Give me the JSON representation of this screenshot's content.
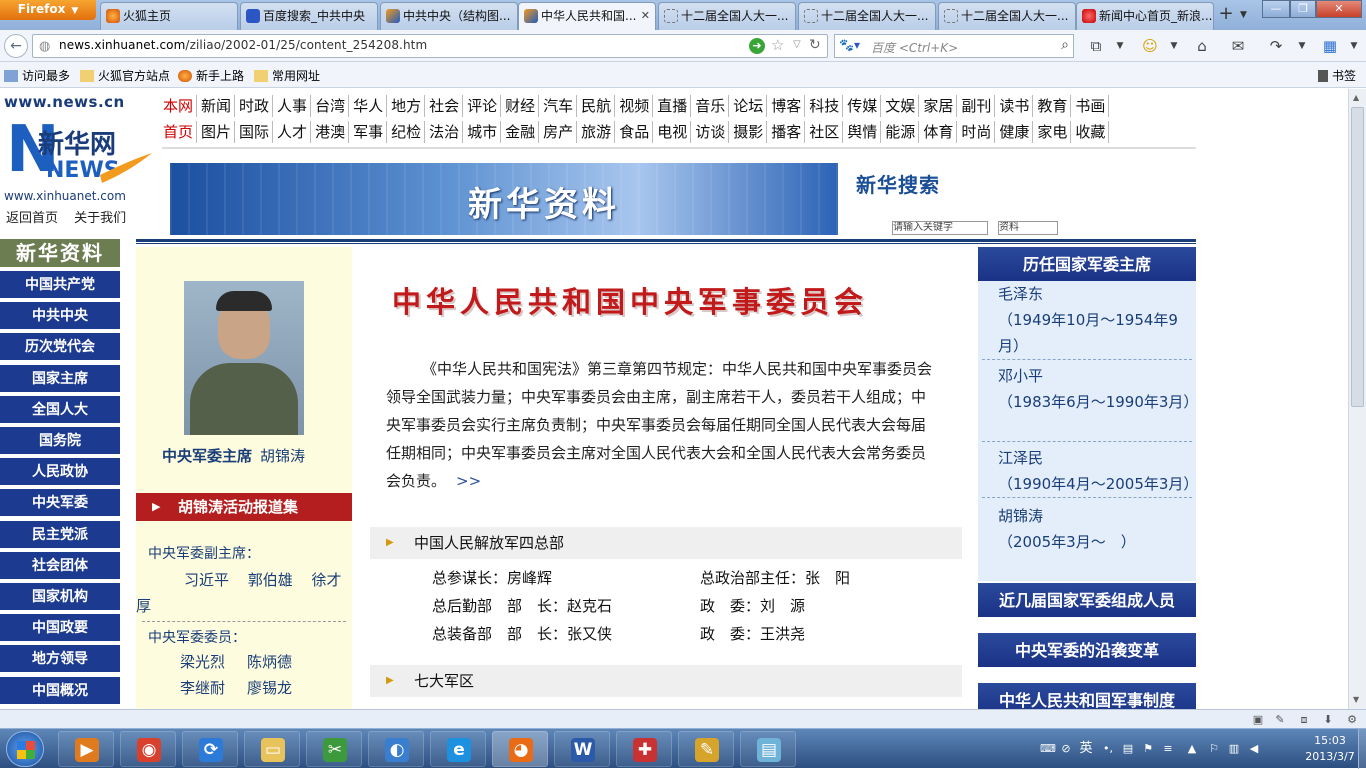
{
  "browser": {
    "app_button": "Firefox",
    "tabs": [
      {
        "label": "火狐主页",
        "icon": "firefox-icon"
      },
      {
        "label": "百度搜索_中共中央",
        "icon": "baidu-icon"
      },
      {
        "label": "中共中央（结构图...",
        "icon": "xinhua-icon"
      },
      {
        "label": "中华人民共和国...",
        "icon": "xinhua-icon"
      },
      {
        "label": "十二届全国人大一...",
        "icon": "blank-page-icon"
      },
      {
        "label": "十二届全国人大一...",
        "icon": "blank-page-icon"
      },
      {
        "label": "十二届全国人大一...",
        "icon": "blank-page-icon"
      },
      {
        "label": "新闻中心首页_新浪...",
        "icon": "sina-icon"
      }
    ],
    "url_host": "news.xinhuanet.com",
    "url_path": "/ziliao/2002-01/25/content_254208.htm",
    "search_placeholder": "百度 <Ctrl+K>",
    "bookmarks": [
      "访问最多",
      "火狐官方站点",
      "新手上路",
      "常用网址"
    ],
    "bookmarks_right": "书签"
  },
  "site": {
    "logo_top": "www.news.cn",
    "logo_main": "新华网",
    "logo_news": "NEWS",
    "logo_bottom": "www.xinhuanet.com",
    "logo_links": [
      "返回首页",
      "关于我们"
    ],
    "channels_row1": [
      "本网",
      "新闻",
      "时政",
      "人事",
      "台湾",
      "华人",
      "地方",
      "社会",
      "评论",
      "财经",
      "汽车",
      "民航",
      "视频",
      "直播",
      "音乐",
      "论坛",
      "博客",
      "科技",
      "传媒",
      "文娱",
      "家居",
      "副刊",
      "读书",
      "教育",
      "书画"
    ],
    "channels_row2": [
      "首页",
      "图片",
      "国际",
      "人才",
      "港澳",
      "军事",
      "纪检",
      "法治",
      "城市",
      "金融",
      "房产",
      "旅游",
      "食品",
      "电视",
      "访谈",
      "摄影",
      "播客",
      "社区",
      "舆情",
      "能源",
      "体育",
      "时尚",
      "健康",
      "家电",
      "收藏"
    ],
    "banner_text": "新华资料",
    "search_title": "新华搜索",
    "search_input": "请输入关键字",
    "search_select": "资料"
  },
  "left_nav": {
    "title": "新华资料",
    "items": [
      "中国共产党",
      "中共中央",
      "历次党代会",
      "国家主席",
      "全国人大",
      "国务院",
      "人民政协",
      "中央军委",
      "民主党派",
      "社会团体",
      "国家机构",
      "中国政要",
      "地方领导",
      "中国概况"
    ]
  },
  "leader": {
    "chair_label": "中央军委主席",
    "chair_name": "胡锦涛",
    "report_bar": "胡锦涛活动报道集",
    "vice_label": "中央军委副主席：",
    "vice_names": "习近平 郭伯雄 徐才厚",
    "member_label": "中央军委委员：",
    "members_row1": [
      "梁光烈",
      "陈炳德"
    ],
    "members_row2": [
      "李继耐",
      "廖锡龙"
    ]
  },
  "main": {
    "title": "中华人民共和国中央军事委员会",
    "intro": "《中华人民共和国宪法》第三章第四节规定：中华人民共和国中央军事委员会领导全国武装力量；中央军事委员会由主席，副主席若干人，委员若干人组成；中央军事委员会实行主席负责制；中央军事委员会每届任期同全国人民代表大会每届任期相同；中央军事委员会主席对全国人民代表大会和全国人民代表大会常务委员会负责。",
    "more": ">>",
    "section1": "中国人民解放军四总部",
    "hq_rows": [
      {
        "a": "总参谋长：房峰辉",
        "b": "总政治部主任：张　阳"
      },
      {
        "a": "总后勤部　部　长：赵克石",
        "b": "政　委：刘　源"
      },
      {
        "a": "总装备部　部　长：张又侠",
        "b": "政　委：王洪尧"
      }
    ],
    "section2": "七大军区"
  },
  "right": {
    "title": "历任国家军委主席",
    "chairs": [
      {
        "name": "毛泽东",
        "years": "（1949年10月～1954年9月）"
      },
      {
        "name": "邓小平",
        "years": "（1983年6月～1990年3月）"
      },
      {
        "name": "江泽民",
        "years": "（1990年4月～2005年3月）"
      },
      {
        "name": "胡锦涛",
        "years": "（2005年3月～　）"
      }
    ],
    "box1": "近几届国家军委组成人员",
    "box2": "中央军委的沿袭变革",
    "box3": "中华人民共和国军事制度"
  },
  "taskbar": {
    "apps": [
      "media-player-icon",
      "chrome-icon",
      "sync-icon",
      "explorer-folder-icon",
      "green-app-icon",
      "messenger-icon",
      "ie-icon",
      "firefox-icon",
      "word-icon",
      "red-app-icon",
      "paint-icon",
      "notepad-icon"
    ],
    "ime": "英",
    "time": "15:03",
    "date": "2013/3/7"
  }
}
